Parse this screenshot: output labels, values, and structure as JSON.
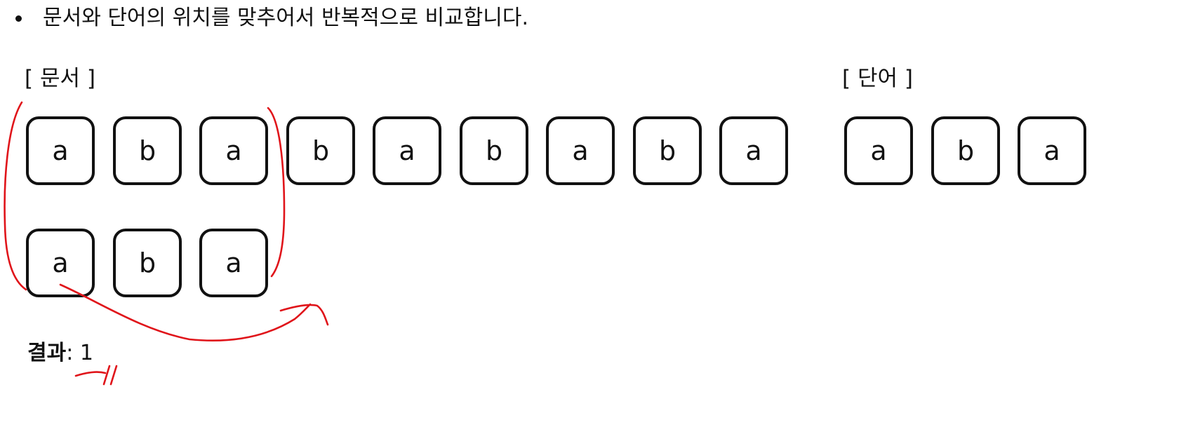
{
  "instruction": {
    "bullet": "•",
    "text": "문서와 단어의 위치를 맞추어서 반복적으로 비교합니다."
  },
  "document": {
    "label": "[ 문서 ]",
    "cells": [
      "a",
      "b",
      "a",
      "b",
      "a",
      "b",
      "a",
      "b",
      "a"
    ]
  },
  "word": {
    "label": "[ 단어 ]",
    "cells": [
      "a",
      "b",
      "a"
    ]
  },
  "comparison": {
    "cells": [
      "a",
      "b",
      "a"
    ]
  },
  "result": {
    "label": "결과",
    "separator": ": ",
    "value": "1"
  },
  "colors": {
    "cell_border": "#111111",
    "annotation": "#e0141a"
  }
}
